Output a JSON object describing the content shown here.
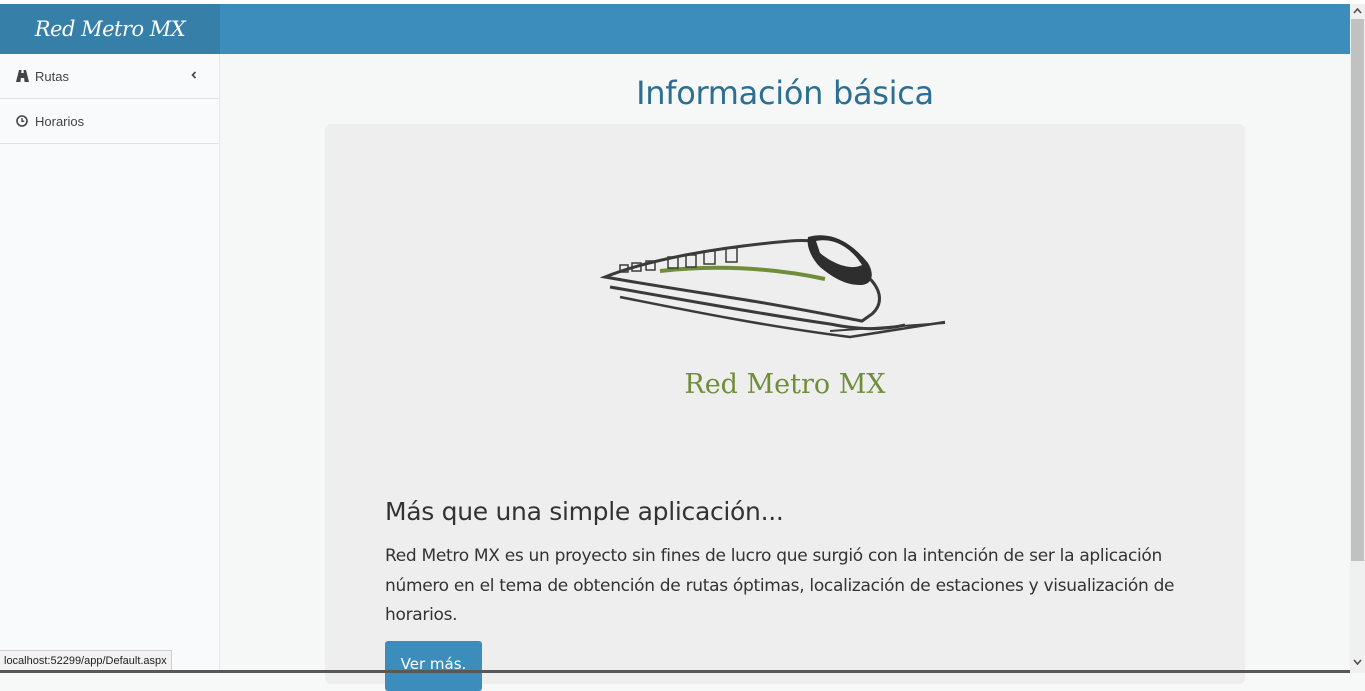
{
  "brand": {
    "title": "Red Metro MX"
  },
  "sidebar": {
    "items": [
      {
        "label": "Rutas",
        "icon": "road-icon",
        "has_submenu": true
      },
      {
        "label": "Horarios",
        "icon": "clock-icon",
        "has_submenu": false
      }
    ]
  },
  "main": {
    "title": "Información básica",
    "jumbotron": {
      "logo_text": "Red Metro MX",
      "heading": "Más que una simple aplicación...",
      "body": "Red Metro MX es un proyecto sin fines de lucro que surgió con la intención de ser la aplicación número en el tema de obtención de rutas óptimas, localización de estaciones y visualización de horarios.",
      "button_label": "Ver más."
    }
  },
  "status_bar": {
    "url": "localhost:52299/app/Default.aspx"
  },
  "colors": {
    "header": "#3c8dbc",
    "brand_bg": "#367fa9",
    "title": "#2c6f93",
    "logo_green": "#6f8e3a"
  }
}
